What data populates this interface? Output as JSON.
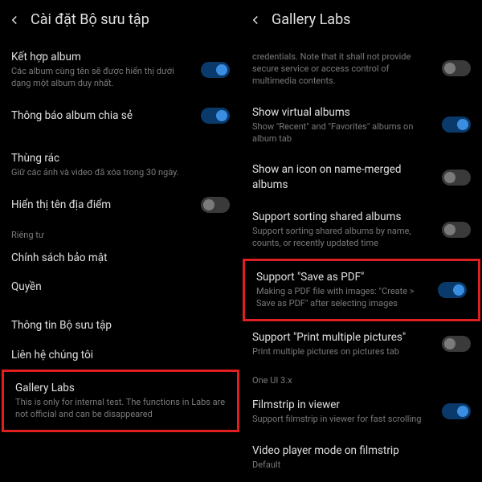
{
  "left": {
    "header_title": "Cài đặt Bộ sưu tập",
    "items": {
      "combine_album": {
        "title": "Kết hợp album",
        "subtitle": "Các album cùng tên sẽ được hiển thị dưới dạng một album duy nhất."
      },
      "shared_notify": {
        "title": "Thông báo album chia sẻ"
      },
      "trash": {
        "title": "Thùng rác",
        "subtitle": "Giữ các ảnh và video đã xóa trong 30 ngày."
      },
      "show_location": {
        "title": "Hiển thị tên địa điểm"
      },
      "privacy_label": "Riêng tư",
      "privacy_policy": {
        "title": "Chính sách bảo mật"
      },
      "permissions": {
        "title": "Quyền"
      },
      "collection_info": {
        "title": "Thông tin Bộ sưu tập"
      },
      "contact_us": {
        "title": "Liên hệ chúng tôi"
      },
      "gallery_labs": {
        "title": "Gallery Labs",
        "subtitle": "This is only for internal test. The functions in Labs are not official and can be disappeared"
      }
    }
  },
  "right": {
    "header_title": "Gallery Labs",
    "items": {
      "credentials": {
        "subtitle": "credentials. Note that it shall not provide secure service or access control of multimedia contents."
      },
      "virtual_albums": {
        "title": "Show virtual albums",
        "subtitle": "Show \"Recent\" and \"Favorites\" albums on album tab"
      },
      "name_merged_icon": {
        "title": "Show an icon on name-merged albums"
      },
      "sorting_shared": {
        "title": "Support sorting shared albums",
        "subtitle": "Support sorting shared albums by name, counts, or recently updated time"
      },
      "save_as_pdf": {
        "title": "Support \"Save as PDF\"",
        "subtitle": "Making a PDF file with images: \"Create > Save as PDF\" after selecting images"
      },
      "print_multiple": {
        "title": "Support \"Print multiple pictures\"",
        "subtitle": "Print multiple pictures on pictures tab"
      },
      "oneui_label": "One UI 3.x",
      "filmstrip": {
        "title": "Filmstrip in viewer",
        "subtitle": "Support filmstrip in viewer for fast scrolling"
      },
      "video_filmstrip": {
        "title": "Video player mode on filmstrip",
        "subtitle": "Default"
      }
    }
  }
}
